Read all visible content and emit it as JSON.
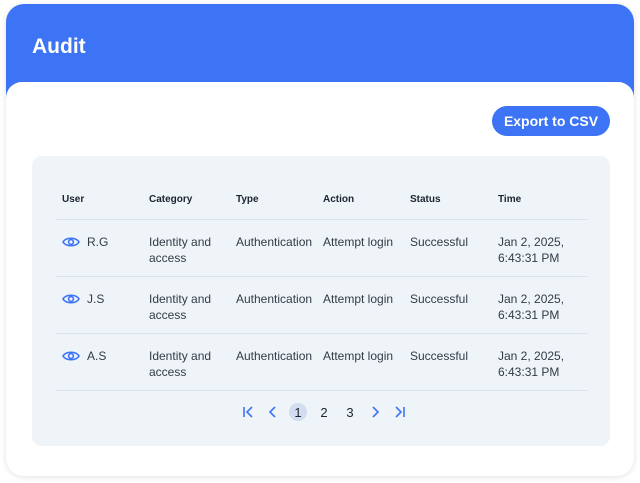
{
  "header": {
    "title": "Audit"
  },
  "toolbar": {
    "export_label": "Export to CSV"
  },
  "table": {
    "columns": [
      "User",
      "Category",
      "Type",
      "Action",
      "Status",
      "Time"
    ],
    "rows": [
      {
        "user": "R.G",
        "category": "Identity and access",
        "type": "Authentication",
        "action": "Attempt login",
        "status": "Successful",
        "time": "Jan 2, 2025, 6:43:31 PM"
      },
      {
        "user": "J.S",
        "category": "Identity and access",
        "type": "Authentication",
        "action": "Attempt login",
        "status": "Successful",
        "time": "Jan 2, 2025, 6:43:31 PM"
      },
      {
        "user": "A.S",
        "category": "Identity and access",
        "type": "Authentication",
        "action": "Attempt login",
        "status": "Successful",
        "time": "Jan 2, 2025, 6:43:31 PM"
      }
    ]
  },
  "pagination": {
    "pages": [
      "1",
      "2",
      "3"
    ],
    "current": "1",
    "icons": [
      "first-page-icon",
      "previous-page-icon",
      "next-page-icon",
      "last-page-icon"
    ]
  },
  "colors": {
    "accent": "#3d73f5",
    "table_bg": "#eff4f9",
    "active_page_bg": "#d3ddf1"
  }
}
